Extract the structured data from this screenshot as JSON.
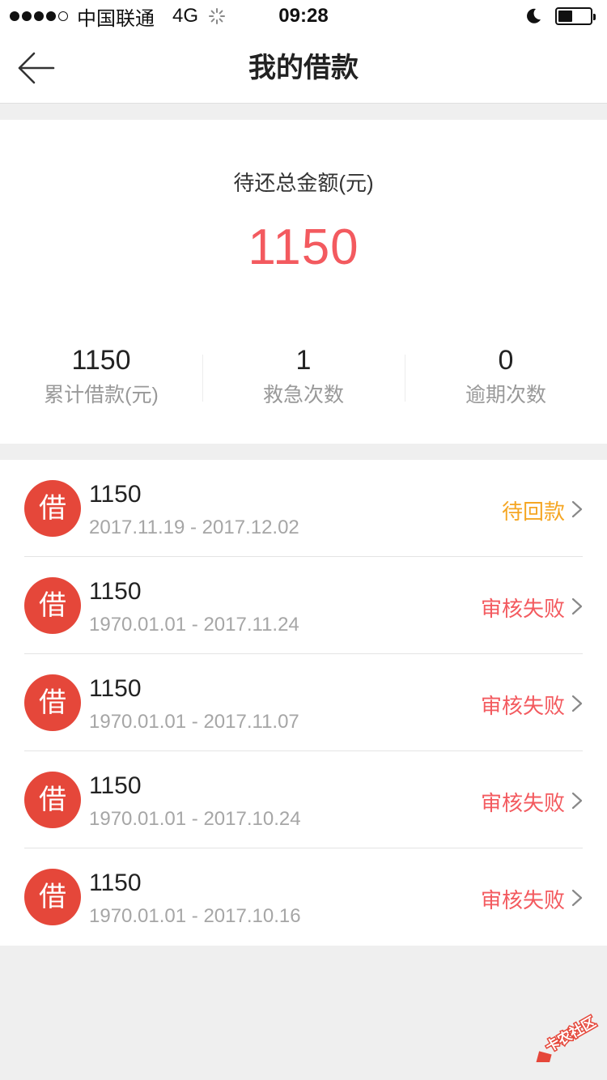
{
  "status_bar": {
    "carrier": "中国联通",
    "network": "4G",
    "time": "09:28",
    "battery_level": 0.45
  },
  "nav": {
    "title": "我的借款"
  },
  "summary": {
    "label": "待还总金额(元)",
    "amount": "1150",
    "amount_color": "#f35a5f",
    "stats": [
      {
        "value": "1150",
        "label": "累计借款(元)"
      },
      {
        "value": "1",
        "label": "救急次数"
      },
      {
        "value": "0",
        "label": "逾期次数"
      }
    ]
  },
  "loans": [
    {
      "icon_text": "借",
      "amount": "1150",
      "period": "2017.11.19 - 2017.12.02",
      "status": "待回款",
      "status_color": "#f5a623"
    },
    {
      "icon_text": "借",
      "amount": "1150",
      "period": "1970.01.01 - 2017.11.24",
      "status": "审核失败",
      "status_color": "#f35a5f"
    },
    {
      "icon_text": "借",
      "amount": "1150",
      "period": "1970.01.01 - 2017.11.07",
      "status": "审核失败",
      "status_color": "#f35a5f"
    },
    {
      "icon_text": "借",
      "amount": "1150",
      "period": "1970.01.01 - 2017.10.24",
      "status": "审核失败",
      "status_color": "#f35a5f"
    },
    {
      "icon_text": "借",
      "amount": "1150",
      "period": "1970.01.01 - 2017.10.16",
      "status": "审核失败",
      "status_color": "#f35a5f"
    }
  ],
  "watermark": {
    "text": "卡农社区"
  },
  "icons": {
    "back": "back-arrow-icon",
    "chevron": "chevron-right-icon",
    "moon": "moon-icon",
    "battery": "battery-icon",
    "spinner": "loading-spinner-icon"
  },
  "colors": {
    "accent": "#e5473a",
    "background": "#efefef"
  }
}
